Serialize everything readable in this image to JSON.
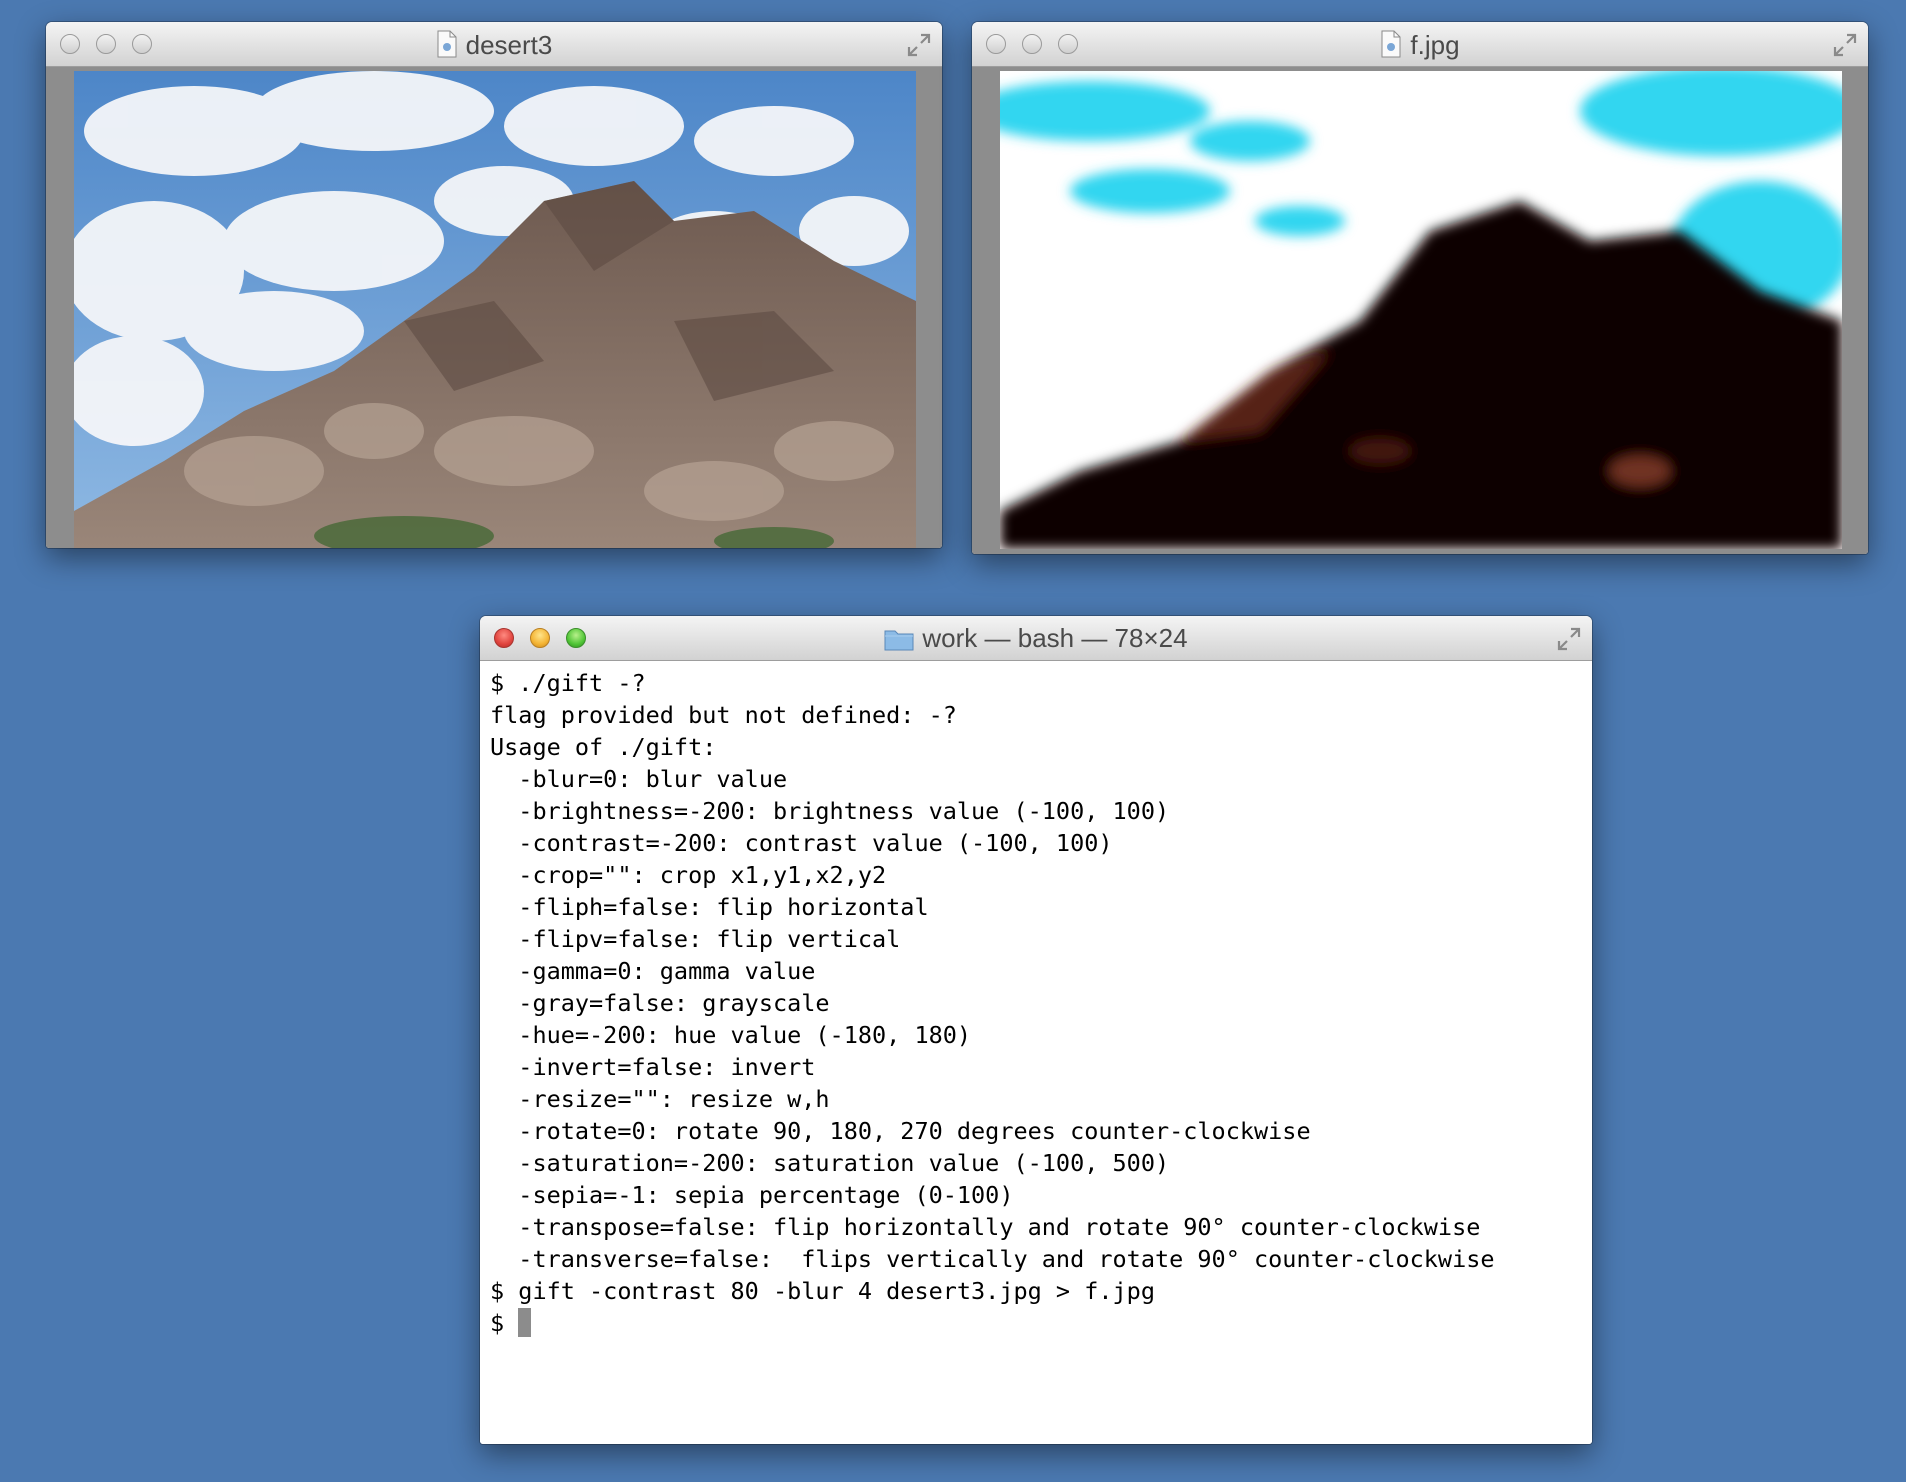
{
  "windows": {
    "image1": {
      "title": "desert3",
      "icon": "image-file-icon"
    },
    "image2": {
      "title": "f.jpg",
      "icon": "image-file-icon"
    },
    "terminal": {
      "title": "work — bash — 78×24",
      "icon": "folder-icon"
    }
  },
  "terminal": {
    "lines": [
      "$ ./gift -?",
      "flag provided but not defined: -?",
      "Usage of ./gift:",
      "  -blur=0: blur value",
      "  -brightness=-200: brightness value (-100, 100)",
      "  -contrast=-200: contrast value (-100, 100)",
      "  -crop=\"\": crop x1,y1,x2,y2",
      "  -fliph=false: flip horizontal",
      "  -flipv=false: flip vertical",
      "  -gamma=0: gamma value",
      "  -gray=false: grayscale",
      "  -hue=-200: hue value (-180, 180)",
      "  -invert=false: invert",
      "  -resize=\"\": resize w,h",
      "  -rotate=0: rotate 90, 180, 270 degrees counter-clockwise",
      "  -saturation=-200: saturation value (-100, 500)",
      "  -sepia=-1: sepia percentage (0-100)",
      "  -transpose=false: flip horizontally and rotate 90° counter-clockwise",
      "  -transverse=false:  flips vertically and rotate 90° counter-clockwise",
      "$ gift -contrast 80 -blur 4 desert3.jpg > f.jpg"
    ],
    "prompt": "$ "
  },
  "colors": {
    "desktop": "#4b79b1",
    "sky": "#6fa3d8",
    "rock": "#8a7468",
    "processed_sky": "#33d6f0"
  }
}
